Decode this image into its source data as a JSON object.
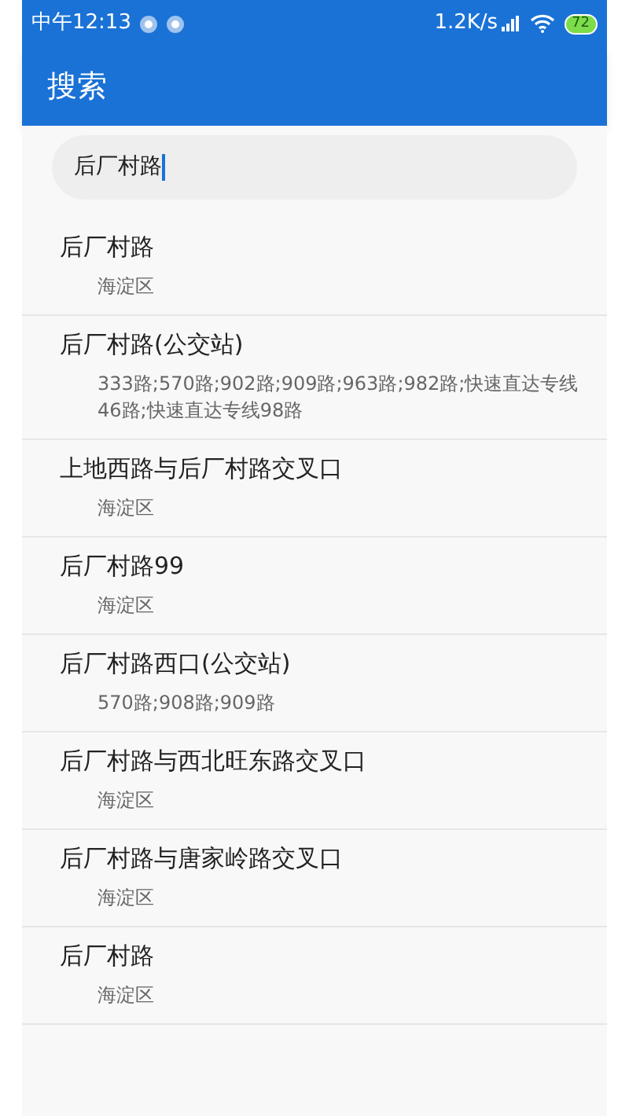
{
  "status_bar": {
    "time": "中午12:13",
    "speed": "1.2K/s",
    "battery": "72"
  },
  "app_bar": {
    "title": "搜索"
  },
  "search": {
    "value": "后厂村路"
  },
  "results": [
    {
      "name": "后厂村路",
      "detail": "海淀区"
    },
    {
      "name": "后厂村路(公交站)",
      "detail": "333路;570路;902路;909路;963路;982路;快速直达专线46路;快速直达专线98路"
    },
    {
      "name": "上地西路与后厂村路交叉口",
      "detail": "海淀区"
    },
    {
      "name": "后厂村路99",
      "detail": "海淀区"
    },
    {
      "name": "后厂村路西口(公交站)",
      "detail": "570路;908路;909路"
    },
    {
      "name": "后厂村路与西北旺东路交叉口",
      "detail": "海淀区"
    },
    {
      "name": "后厂村路与唐家岭路交叉口",
      "detail": "海淀区"
    },
    {
      "name": "后厂村路",
      "detail": "海淀区"
    }
  ]
}
